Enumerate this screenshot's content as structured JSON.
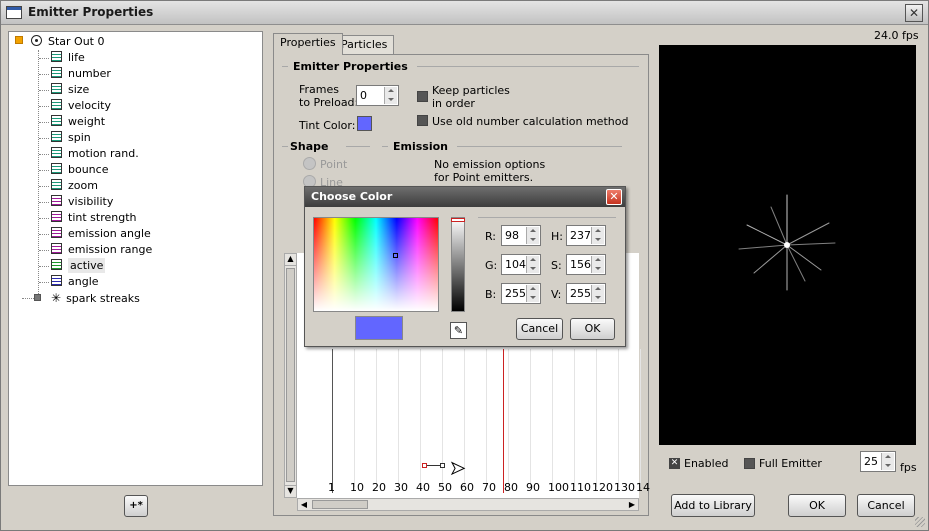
{
  "window": {
    "title": "Emitter Properties",
    "close": "✕"
  },
  "tree": {
    "root": {
      "label": "Star Out 0"
    },
    "items": [
      {
        "label": "life",
        "color": "#1a9a7a"
      },
      {
        "label": "number",
        "color": "#1a9a7a"
      },
      {
        "label": "size",
        "color": "#1a9a7a"
      },
      {
        "label": "velocity",
        "color": "#1a9a7a"
      },
      {
        "label": "weight",
        "color": "#1a9a7a"
      },
      {
        "label": "spin",
        "color": "#1a9a7a"
      },
      {
        "label": "motion rand.",
        "color": "#1a9a7a"
      },
      {
        "label": "bounce",
        "color": "#1a9a7a"
      },
      {
        "label": "zoom",
        "color": "#1a9a7a"
      },
      {
        "label": "visibility",
        "color": "#a01a9a"
      },
      {
        "label": "tint strength",
        "color": "#a01a9a"
      },
      {
        "label": "emission angle",
        "color": "#a01a9a"
      },
      {
        "label": "emission range",
        "color": "#a01a9a"
      },
      {
        "label": "active",
        "color": "#1a9a2a",
        "selected": true
      },
      {
        "label": "angle",
        "color": "#2a2ab0"
      }
    ],
    "child": {
      "label": "spark streaks"
    },
    "add_button": "+*"
  },
  "tabs": [
    {
      "label": "Properties",
      "active": true
    },
    {
      "label": "Particles",
      "active": false
    }
  ],
  "emitter": {
    "group": "Emitter Properties",
    "frames_label_1": "Frames",
    "frames_label_2": "to Preload:",
    "frames_value": "0",
    "tint_label": "Tint Color:",
    "tint_color": "#6266ff",
    "keep_label_1": "Keep particles",
    "keep_label_2": "in order",
    "old_calc_label": "Use old number calculation method",
    "shape_group": "Shape",
    "shape_point": "Point",
    "shape_line": "Line",
    "emission_group": "Emission",
    "emission_text_1": "No emission options",
    "emission_text_2": "for Point emitters."
  },
  "graph": {
    "ticks": [
      "1",
      "10",
      "20",
      "30",
      "40",
      "50",
      "60",
      "70",
      "80",
      "90",
      "100",
      "110",
      "120",
      "130",
      "14"
    ]
  },
  "preview": {
    "fps_readout": "24.0 fps",
    "enabled_label": "Enabled",
    "full_emitter_label": "Full Emitter",
    "fps_value": "25",
    "fps_unit": "fps"
  },
  "buttons": {
    "add_library": "Add to Library",
    "ok": "OK",
    "cancel": "Cancel"
  },
  "color_dialog": {
    "title": "Choose Color",
    "close": "✕",
    "r_label": "R:",
    "r_value": "98",
    "g_label": "G:",
    "g_value": "104",
    "b_label": "B:",
    "b_value": "255",
    "h_label": "H:",
    "h_value": "237",
    "s_label": "S:",
    "s_value": "156",
    "v_label": "V:",
    "v_value": "255",
    "swatch_color": "#6266ff",
    "cancel": "Cancel",
    "ok": "OK"
  }
}
